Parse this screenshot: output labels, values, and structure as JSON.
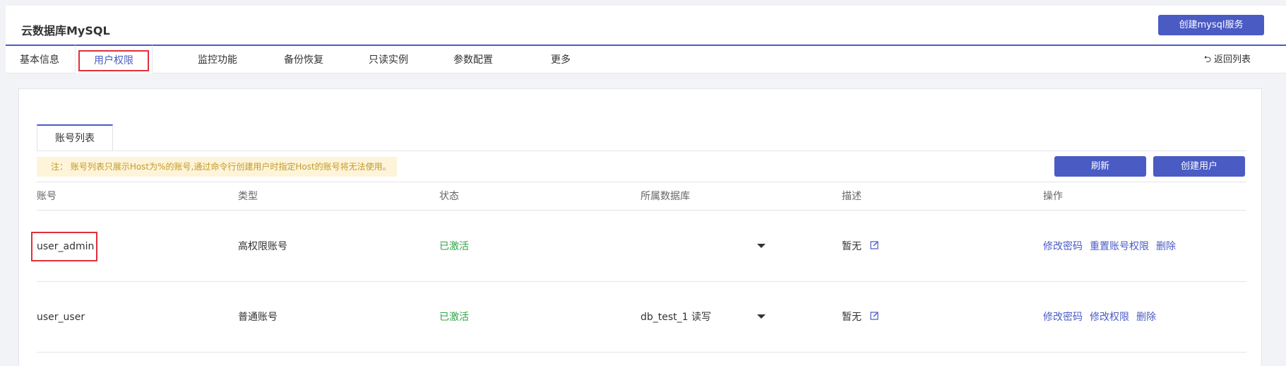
{
  "header": {
    "title": "云数据库MySQL",
    "create_service_label": "创建mysql服务"
  },
  "tabs": [
    {
      "label": "基本信息"
    },
    {
      "label": "用户权限"
    },
    {
      "label": "监控功能"
    },
    {
      "label": "备份恢复"
    },
    {
      "label": "只读实例"
    },
    {
      "label": "参数配置"
    },
    {
      "label": "更多"
    }
  ],
  "back_label": "返回列表",
  "subtab_label": "账号列表",
  "note": "注：  账号列表只展示Host为%的账号,通过命令行创建用户时指定Host的账号将无法使用。",
  "buttons": {
    "refresh": "刷新",
    "create_user": "创建用户"
  },
  "table": {
    "headers": [
      "账号",
      "类型",
      "状态",
      "所属数据库",
      "描述",
      "操作"
    ],
    "rows": [
      {
        "account": "user_admin",
        "type": "高权限账号",
        "status": "已激活",
        "database": "",
        "description": "暂无",
        "actions": [
          "修改密码",
          "重置账号权限",
          "删除"
        ]
      },
      {
        "account": "user_user",
        "type": "普通账号",
        "status": "已激活",
        "database": "db_test_1 读写",
        "description": "暂无",
        "actions": [
          "修改密码",
          "修改权限",
          "删除"
        ]
      }
    ]
  },
  "colors": {
    "accent": "#4a5bc4",
    "status_active": "#2fa34a",
    "highlight": "#e0303a",
    "note_bg": "#fdf4d9"
  }
}
